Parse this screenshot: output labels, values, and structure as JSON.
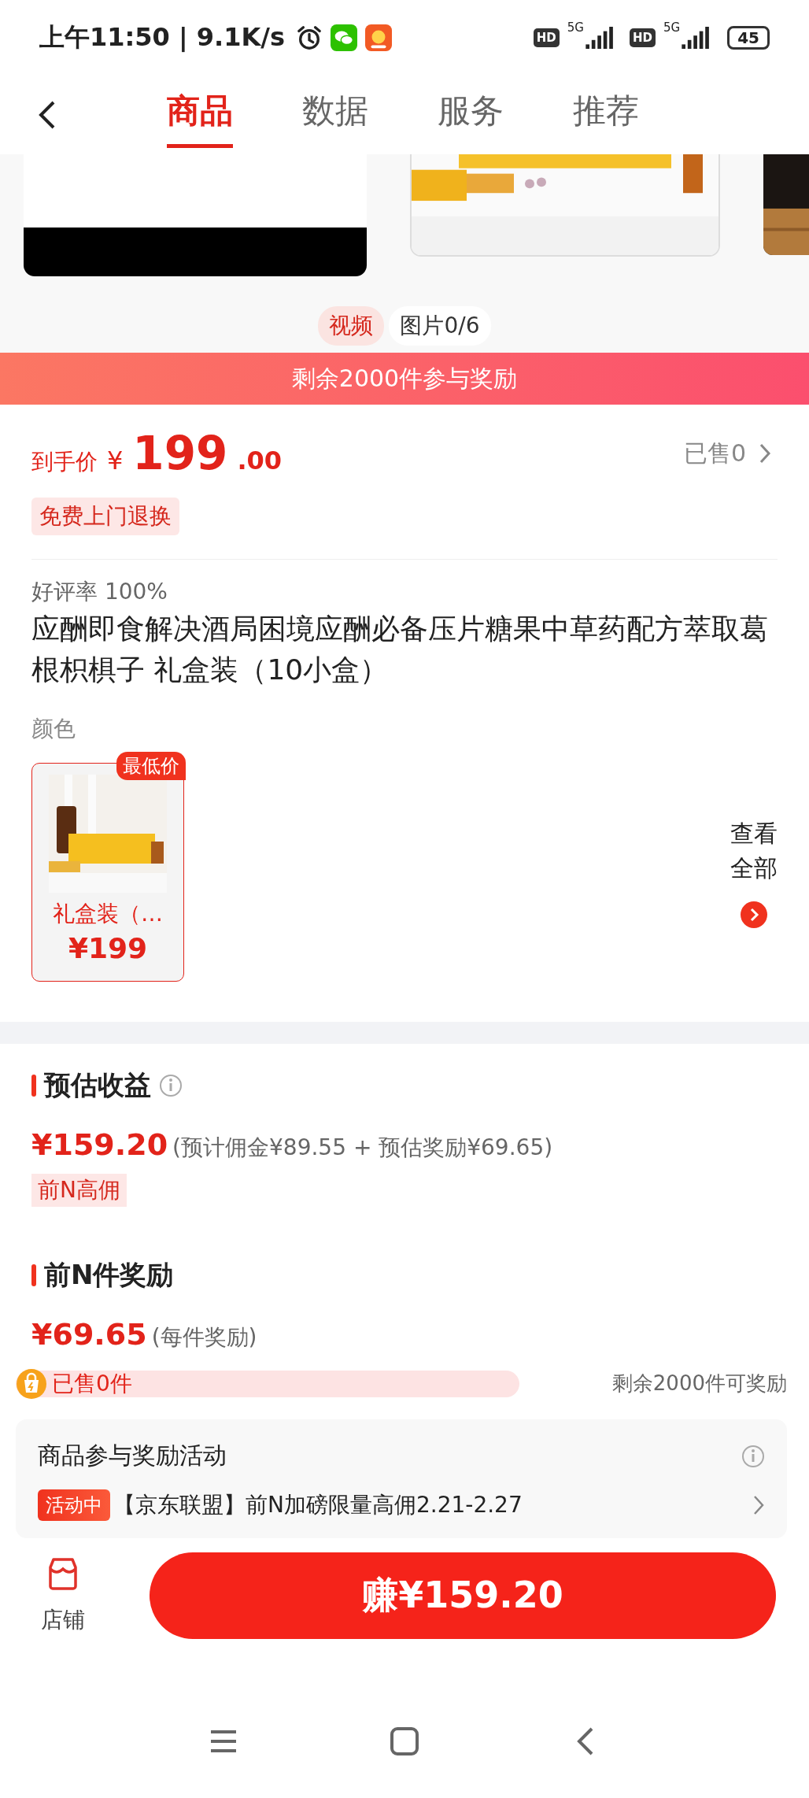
{
  "status_bar": {
    "time": "上午11:50 | 9.1K/s",
    "signals": [
      {
        "badge": "HD",
        "network": "5G"
      },
      {
        "badge": "HD",
        "network": "5G"
      }
    ],
    "battery": "45"
  },
  "nav": {
    "tabs": [
      {
        "label": "商品",
        "selected": true
      },
      {
        "label": "数据",
        "selected": false
      },
      {
        "label": "服务",
        "selected": false
      },
      {
        "label": "推荐",
        "selected": false
      }
    ]
  },
  "gallery": {
    "media_tabs": [
      {
        "label": "视频",
        "selected": true
      },
      {
        "label": "图片0/6",
        "selected": false
      }
    ]
  },
  "banner": "剩余2000件参与奖励",
  "price": {
    "label": "到手价",
    "currency": "¥",
    "integer": "199",
    "decimal": ".00",
    "sold": "已售0",
    "service_tag": "免费上门退换"
  },
  "product": {
    "rating": "好评率 100%",
    "title": "应酬即食解决酒局困境应酬必备压片糖果中草药配方萃取葛根枳椇子 礼盒装（10小盒）",
    "option_label": "颜色",
    "variants": [
      {
        "name": "礼盒装（…",
        "price": "¥199",
        "badge": "最低价",
        "selected": true
      }
    ],
    "view_all": "查看全部"
  },
  "earnings": {
    "title": "预估收益",
    "amount": "¥159.20",
    "breakdown": "(预计佣金¥89.55 + 预估奖励¥69.65)",
    "tag": "前N高佣"
  },
  "reward": {
    "title": "前N件奖励",
    "amount": "¥69.65",
    "note": "(每件奖励)",
    "progress": {
      "label": "已售0件",
      "level": 0,
      "remaining": "剩余2000件可奖励"
    },
    "activity": {
      "title": "商品参与奖励活动",
      "status": "活动中",
      "text": "【京东联盟】前N加磅限量高佣2.21-2.27"
    }
  },
  "bottom": {
    "store": "店铺",
    "earn_button": "赚¥159.20"
  }
}
